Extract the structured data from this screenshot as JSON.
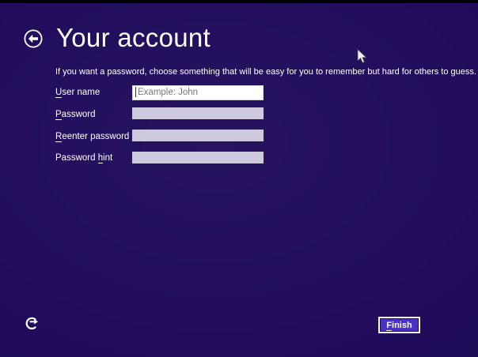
{
  "header": {
    "title": "Your account",
    "back_icon": "circled-left-arrow"
  },
  "instruction": "If you want a password, choose something that will be easy for you to remember but hard for others to guess.",
  "form": {
    "fields": [
      {
        "pre": "",
        "key": "U",
        "post": "ser name",
        "placeholder": "Example: John",
        "value": "",
        "state": "focused"
      },
      {
        "pre": "",
        "key": "P",
        "post": "assword",
        "value": "",
        "state": "disabled"
      },
      {
        "pre": "",
        "key": "R",
        "post": "eenter password",
        "value": "",
        "state": "disabled"
      },
      {
        "pre": "Password ",
        "key": "h",
        "post": "int",
        "value": "",
        "state": "disabled"
      }
    ]
  },
  "footer": {
    "finish_button": {
      "pre": "",
      "key": "F",
      "post": "inish"
    },
    "ease_of_access_icon": "ease-of-access"
  },
  "cursor": {
    "icon": "arrow-pointer"
  },
  "colors": {
    "background": "#200c5b",
    "topbar": "#000000",
    "text": "#ffffff",
    "accent": "#4a33c2",
    "disabled_field": "#cdcade",
    "field_bg": "#ffffff",
    "placeholder": "#767676"
  }
}
